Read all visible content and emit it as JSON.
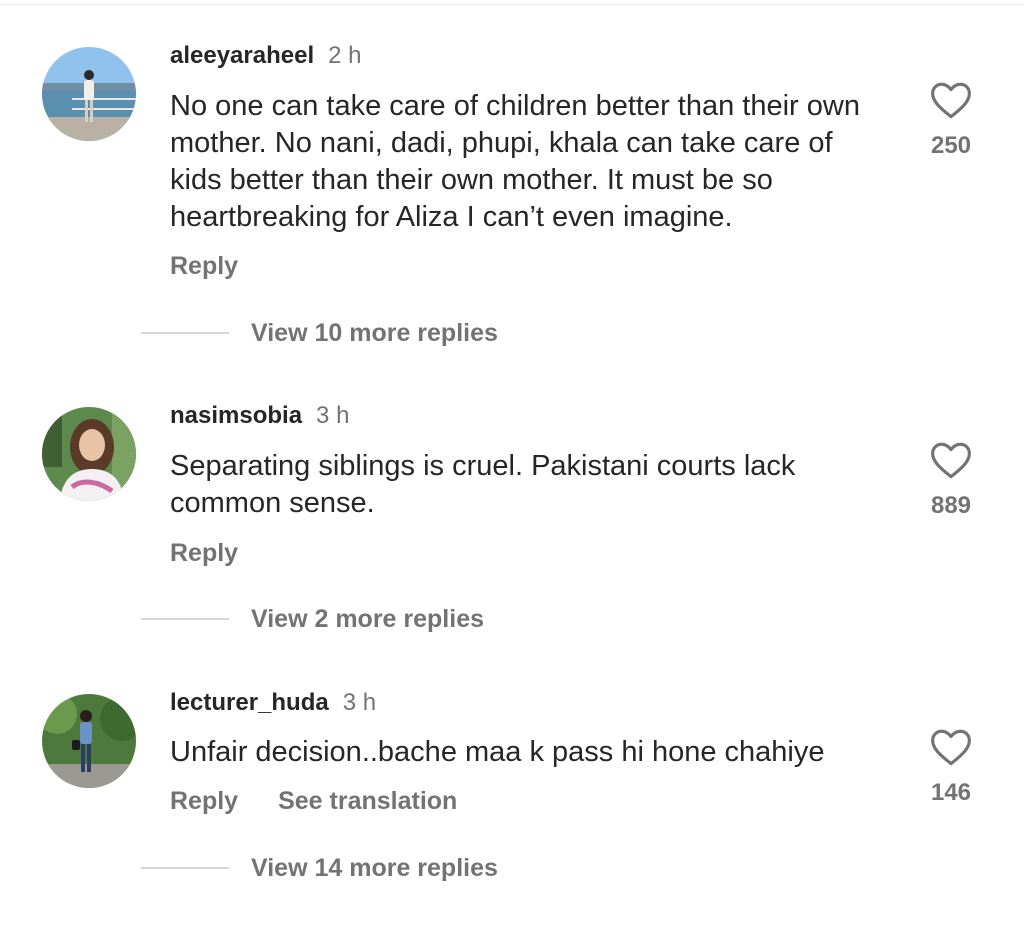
{
  "comments": [
    {
      "username": "aleeyaraheel",
      "time": "2 h",
      "text": "No one can take care of children better than their own mother. No nani, dadi, phupi, khala can take care of kids better than their own mother. It must be so heartbreaking for Aliza I can’t even imagine.",
      "reply_label": "Reply",
      "likes": "250",
      "view_replies": "View 10 more replies",
      "avatar_icon": "profile-photo-waterfront"
    },
    {
      "username": "nasimsobia",
      "time": "3 h",
      "text": "Separating siblings is cruel. Pakistani courts lack common sense.",
      "reply_label": "Reply",
      "likes": "889",
      "view_replies": "View 2 more replies",
      "avatar_icon": "profile-photo-woman"
    },
    {
      "username": "lecturer_huda",
      "time": "3 h",
      "text": "Unfair decision..bache maa k pass hi hone chahiye",
      "reply_label": "Reply",
      "translation_label": "See translation",
      "likes": "146",
      "view_replies": "View 14 more replies",
      "avatar_icon": "profile-photo-garden"
    }
  ],
  "colors": {
    "primary_text": "#262626",
    "secondary_text": "#737373",
    "divider": "#d6d6d6"
  }
}
